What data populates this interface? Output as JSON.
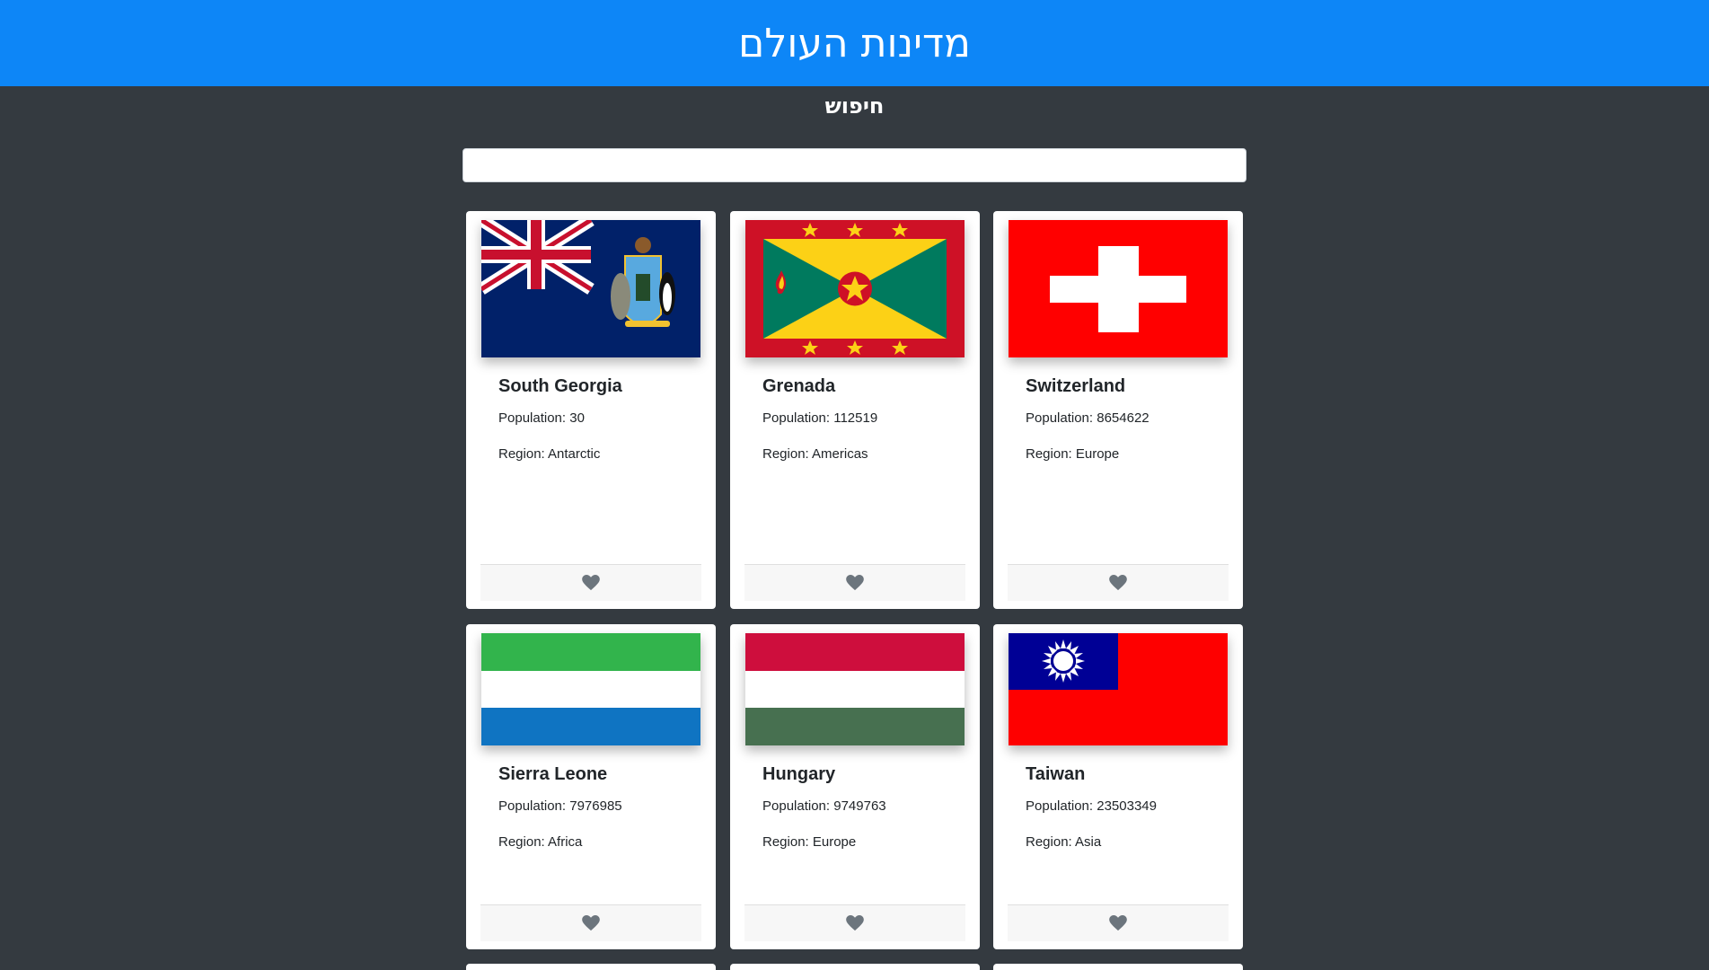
{
  "header": {
    "title": "מדינות העולם"
  },
  "search": {
    "label": "חיפוש",
    "value": "",
    "placeholder": ""
  },
  "countries": [
    {
      "name": "South Georgia",
      "population": "Population: 30",
      "region": "Region: Antarctic",
      "flag": "south-georgia-flag"
    },
    {
      "name": "Grenada",
      "population": "Population: 112519",
      "region": "Region: Americas",
      "flag": "grenada-flag"
    },
    {
      "name": "Switzerland",
      "population": "Population: 8654622",
      "region": "Region: Europe",
      "flag": "switzerland-flag"
    },
    {
      "name": "Sierra Leone",
      "population": "Population: 7976985",
      "region": "Region: Africa",
      "flag": "sierra-leone-flag"
    },
    {
      "name": "Hungary",
      "population": "Population: 9749763",
      "region": "Region: Europe",
      "flag": "hungary-flag"
    },
    {
      "name": "Taiwan",
      "population": "Population: 23503349",
      "region": "Region: Asia",
      "flag": "taiwan-flag"
    }
  ],
  "colors": {
    "header_bg": "#0d86f7",
    "page_bg": "#343a40",
    "heart": "#6c757d"
  }
}
